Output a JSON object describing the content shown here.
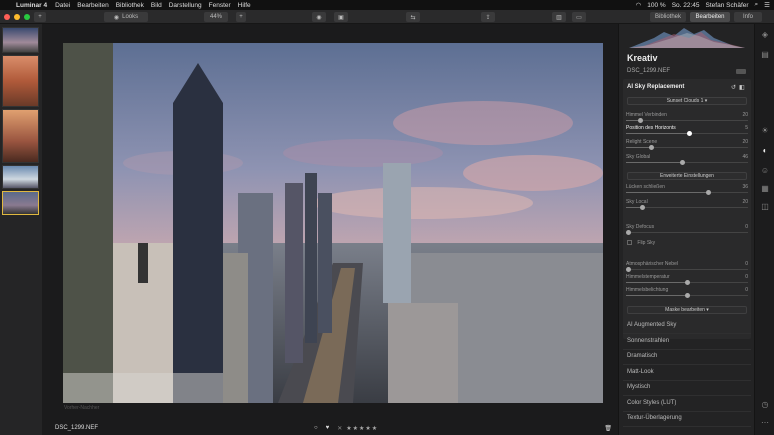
{
  "menubar": {
    "app": "Luminar 4",
    "items": [
      "Datei",
      "Bearbeiten",
      "Bibliothek",
      "Bild",
      "Darstellung",
      "Fenster",
      "Hilfe"
    ],
    "battery": "100 %",
    "clock": "So. 22:45",
    "user": "Stefan Schäfer"
  },
  "toolbar": {
    "looks": "Looks",
    "zoom": "44%",
    "tab_library": "Bibliothek",
    "tab_edit": "Bearbeiten",
    "tab_info": "Info"
  },
  "photo": {
    "filename": "DSC_1299.NEF",
    "watermark": "Vorher-Nachher"
  },
  "bottombar": {
    "filename": "DSC_1299.NEF",
    "stars": "★★★★★"
  },
  "panel": {
    "title": "Kreativ",
    "filename": "DSC_1299.NEF",
    "module_title": "AI Sky Replacement",
    "sky_select": "Sunset Clouds 1",
    "sliders": [
      {
        "label": "Himmel Verbinden",
        "value": "20",
        "level": 0.1
      },
      {
        "label": "Position des Horizonts",
        "value": "5",
        "level": 0.52
      },
      {
        "label": "Relight Scene",
        "value": "20",
        "level": 0.2
      },
      {
        "label": "Sky Global",
        "value": "46",
        "level": 0.46
      },
      {
        "label": "Lücken schließen",
        "value": "36",
        "level": 0.68
      },
      {
        "label": "Sky Local",
        "value": "20",
        "level": 0.12
      },
      {
        "label": "Sky Defocus",
        "value": "0",
        "level": 0.0
      },
      {
        "label": "Atmosphärischer Nebel",
        "value": "0",
        "level": 0.0
      },
      {
        "label": "Himmelstemperatur",
        "value": "0",
        "level": 0.5
      },
      {
        "label": "Himmelsbelichtung",
        "value": "0",
        "level": 0.5
      }
    ],
    "advanced_button": "Erweiterte Einstellungen",
    "flip_sky": "Flip Sky",
    "mask_button": "Maske bearbeiten",
    "filters": [
      "AI Augmented Sky",
      "Sonnenstrahlen",
      "Dramatisch",
      "Matt-Look",
      "Mystisch",
      "Color Styles (LUT)",
      "Textur-Überlagerung"
    ]
  }
}
